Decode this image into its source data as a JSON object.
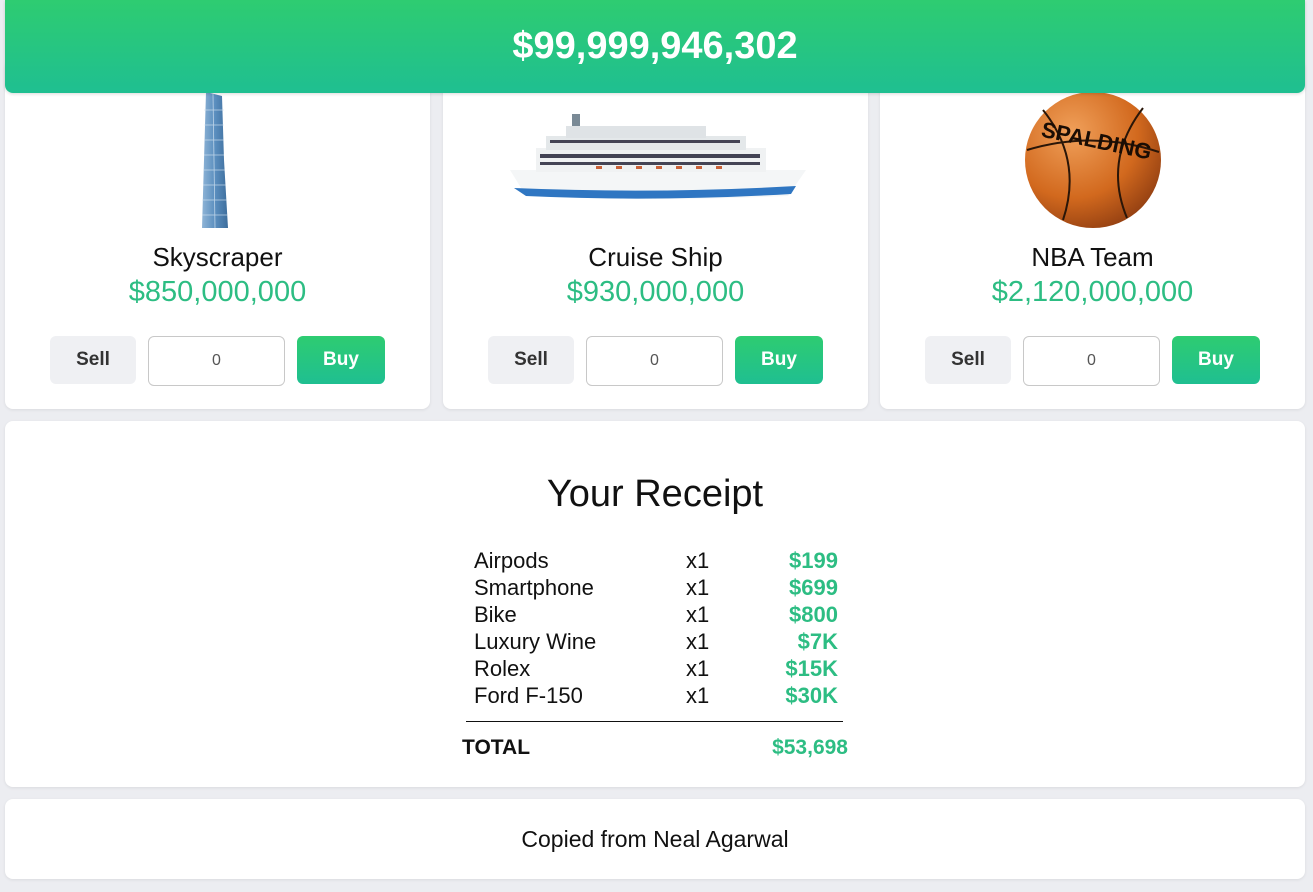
{
  "balance": "$99,999,946,302",
  "products": [
    {
      "name": "Skyscraper",
      "price": "$850,000,000",
      "quantity": "0",
      "sell_label": "Sell",
      "buy_label": "Buy",
      "image": "skyscraper-image"
    },
    {
      "name": "Cruise Ship",
      "price": "$930,000,000",
      "quantity": "0",
      "sell_label": "Sell",
      "buy_label": "Buy",
      "image": "cruise-ship-image"
    },
    {
      "name": "NBA Team",
      "price": "$2,120,000,000",
      "quantity": "0",
      "sell_label": "Sell",
      "buy_label": "Buy",
      "image": "basketball-image",
      "image_text": "SPALDING"
    }
  ],
  "receipt": {
    "title": "Your Receipt",
    "items": [
      {
        "name": "Airpods",
        "qty": "x1",
        "price": "$199"
      },
      {
        "name": "Smartphone",
        "qty": "x1",
        "price": "$699"
      },
      {
        "name": "Bike",
        "qty": "x1",
        "price": "$800"
      },
      {
        "name": "Luxury Wine",
        "qty": "x1",
        "price": "$7K"
      },
      {
        "name": "Rolex",
        "qty": "x1",
        "price": "$15K"
      },
      {
        "name": "Ford F-150",
        "qty": "x1",
        "price": "$30K"
      }
    ],
    "total_label": "TOTAL",
    "total_value": "$53,698"
  },
  "footer": {
    "text": "Copied from Neal Agarwal"
  },
  "colors": {
    "accent": "#2ecc71",
    "accent_dark": "#1fbf91",
    "price_green": "#2dbd83",
    "background": "#ecedf1"
  }
}
